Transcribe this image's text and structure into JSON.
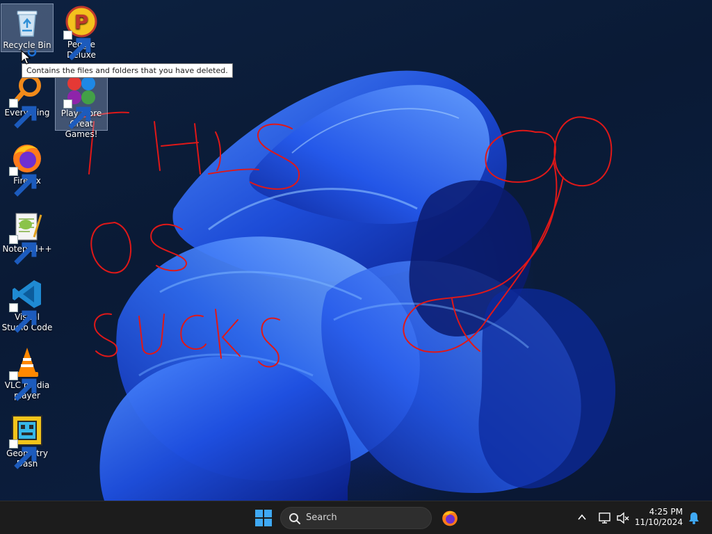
{
  "desktop": {
    "icons": [
      {
        "label": "Recycle Bin",
        "icon": "recycle-bin-icon"
      },
      {
        "label": "Peggle Deluxe",
        "icon": "peggle-icon"
      },
      {
        "label": "Everything",
        "icon": "everything-search-icon"
      },
      {
        "label": "Play More Great Games!",
        "icon": "games-icon"
      },
      {
        "label": "Firefox",
        "icon": "firefox-icon"
      },
      {
        "label": "Notepad++",
        "icon": "notepad-plus-plus-icon"
      },
      {
        "label": "Visual Studio Code",
        "icon": "vscode-icon"
      },
      {
        "label": "VLC media player",
        "icon": "vlc-icon"
      },
      {
        "label": "Geometry Dash",
        "icon": "geometry-dash-icon"
      }
    ],
    "tooltip": "Contains the files and folders that you have deleted.",
    "annotation": {
      "lines": [
        "THIS",
        "OS",
        "SUCKS"
      ],
      "color": "#e01818"
    }
  },
  "taskbar": {
    "search_label": "Search",
    "clock_time": "4:25 PM",
    "clock_date": "11/10/2024",
    "accent": "#3fa9f5"
  }
}
